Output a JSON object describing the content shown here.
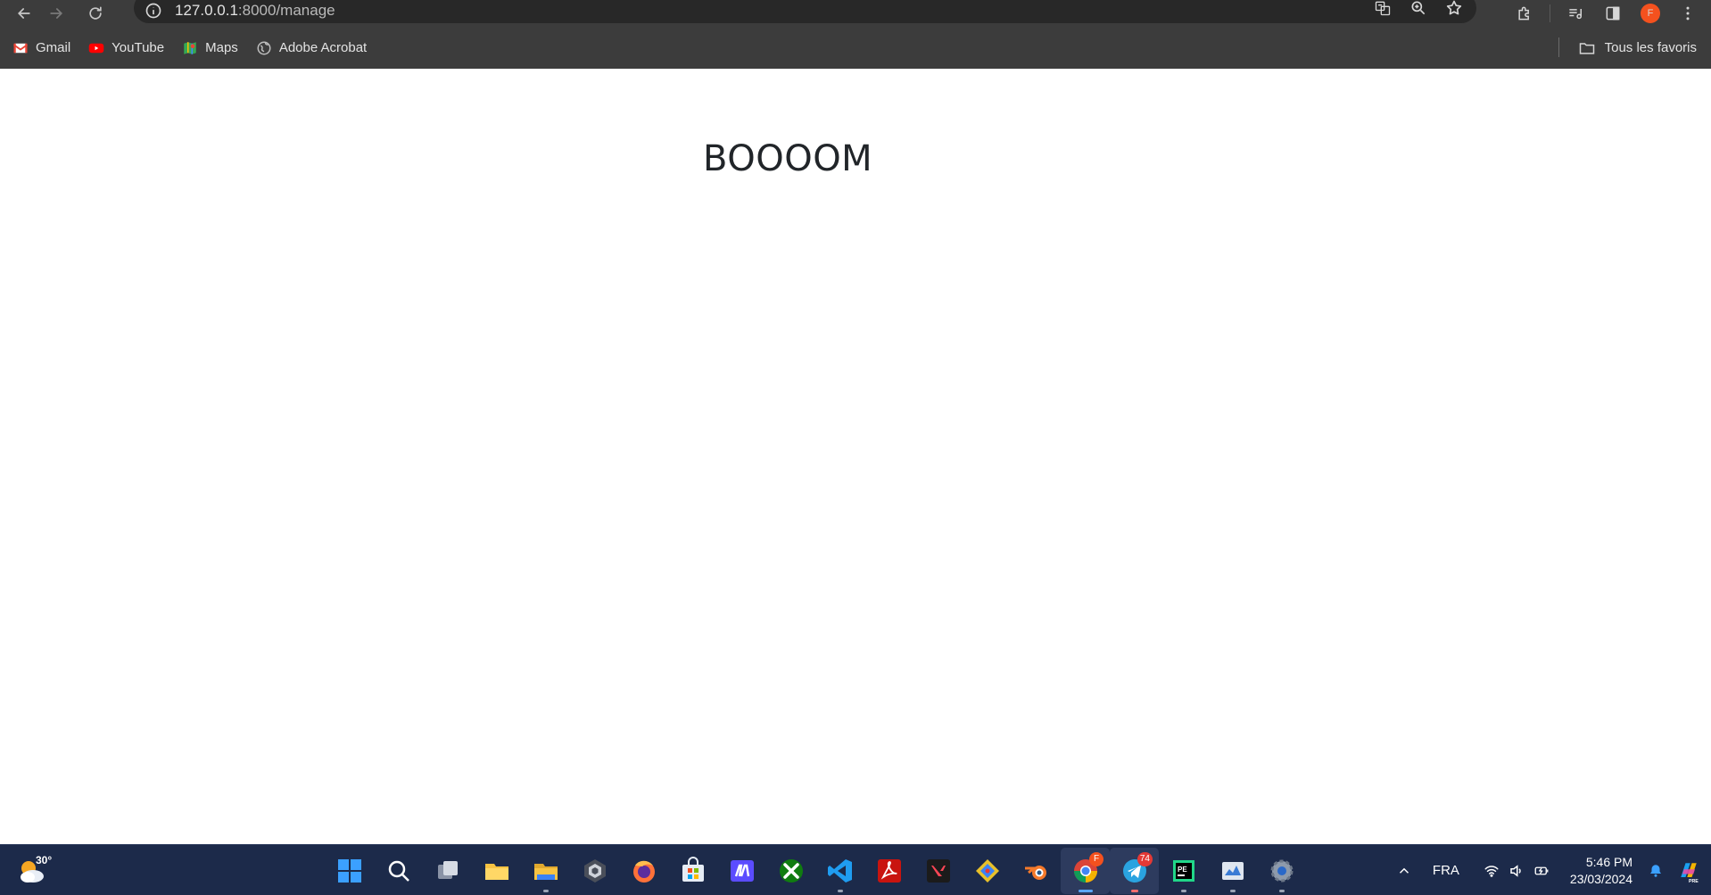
{
  "browser": {
    "url_host": "127.0.0.1",
    "url_path": ":8000/manage",
    "bookmarks": [
      {
        "label": "Gmail",
        "icon": "gmail-icon"
      },
      {
        "label": "YouTube",
        "icon": "youtube-icon"
      },
      {
        "label": "Maps",
        "icon": "maps-icon"
      },
      {
        "label": "Adobe Acrobat",
        "icon": "globe-icon"
      }
    ],
    "all_bookmarks_label": "Tous les favoris",
    "profile_initial": "F"
  },
  "page": {
    "heading": "BOOOOM"
  },
  "taskbar": {
    "weather_temp": "30°",
    "apps": [
      {
        "name": "windows-start-icon"
      },
      {
        "name": "search-icon"
      },
      {
        "name": "task-view-icon"
      },
      {
        "name": "file-explorer-icon"
      },
      {
        "name": "folder-icon"
      },
      {
        "name": "unity-icon"
      },
      {
        "name": "firefox-icon"
      },
      {
        "name": "microsoft-store-icon"
      },
      {
        "name": "app-m-icon"
      },
      {
        "name": "xbox-icon"
      },
      {
        "name": "vscode-icon"
      },
      {
        "name": "acrobat-icon"
      },
      {
        "name": "valorant-icon"
      },
      {
        "name": "git-icon"
      },
      {
        "name": "blender-icon"
      },
      {
        "name": "chrome-icon",
        "badge": "F"
      },
      {
        "name": "telegram-icon",
        "badge": "74"
      },
      {
        "name": "pycharm-icon"
      },
      {
        "name": "task-manager-icon"
      },
      {
        "name": "settings-icon"
      }
    ],
    "language": "FRA",
    "time": "5:46 PM",
    "date": "23/03/2024"
  }
}
